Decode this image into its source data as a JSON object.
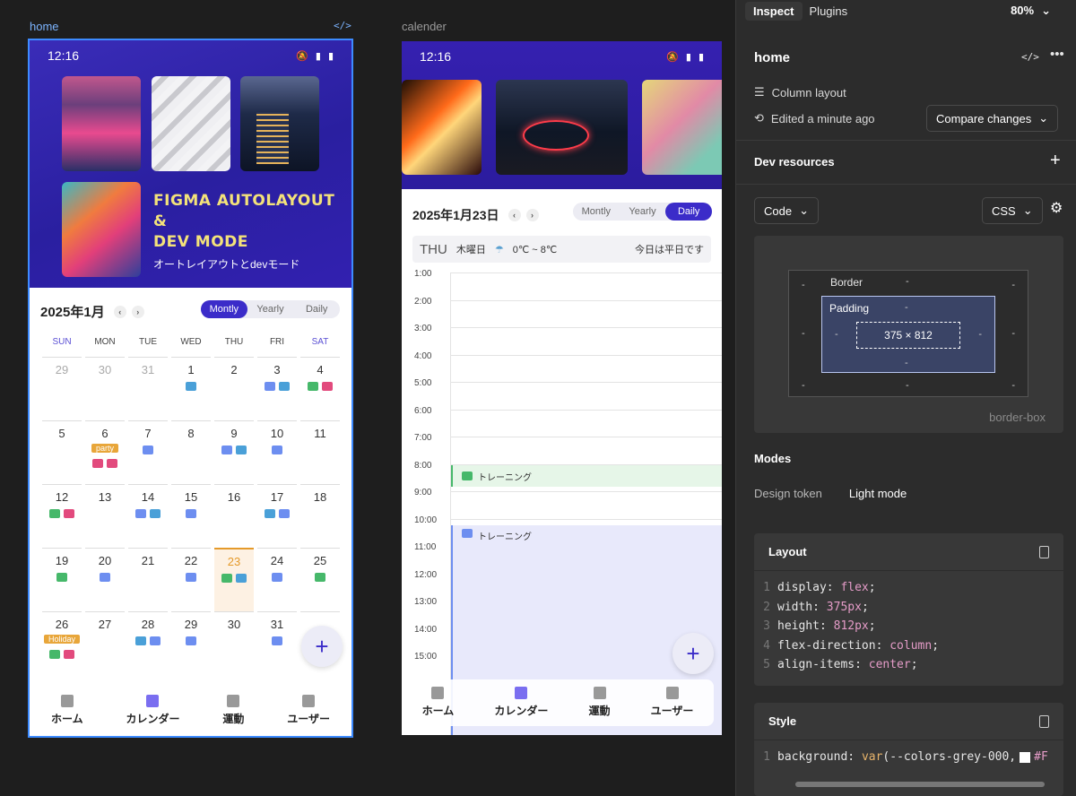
{
  "canvas": {
    "home_label": "home",
    "calender_label": "calender",
    "code_tag": "</>"
  },
  "home": {
    "time": "12:16",
    "hero_title_1": "FIGMA AUTOLAYOUT",
    "hero_title_2": "&",
    "hero_title_3": "DEV MODE",
    "hero_sub": "オートレイアウトとdevモード",
    "month_title": "2025年1月",
    "seg": [
      "Montly",
      "Yearly",
      "Daily"
    ],
    "active_seg": "Montly",
    "dow": [
      "SUN",
      "MON",
      "TUE",
      "WED",
      "THU",
      "FRI",
      "SAT"
    ],
    "days": [
      {
        "d": "29",
        "dim": true,
        "ev": []
      },
      {
        "d": "30",
        "dim": true,
        "ev": []
      },
      {
        "d": "31",
        "dim": true,
        "ev": []
      },
      {
        "d": "1",
        "ev": [
          "bldg"
        ]
      },
      {
        "d": "2",
        "ev": []
      },
      {
        "d": "3",
        "ev": [
          "pc",
          "bldg"
        ]
      },
      {
        "d": "4",
        "ev": [
          "gym",
          "party"
        ]
      },
      {
        "d": "5",
        "ev": []
      },
      {
        "d": "6",
        "tag": "party",
        "ev": [
          "party",
          "party"
        ]
      },
      {
        "d": "7",
        "ev": [
          "pc"
        ]
      },
      {
        "d": "8",
        "ev": []
      },
      {
        "d": "9",
        "ev": [
          "pc",
          "bldg"
        ]
      },
      {
        "d": "10",
        "ev": [
          "pc"
        ]
      },
      {
        "d": "11",
        "ev": []
      },
      {
        "d": "12",
        "ev": [
          "gym",
          "party"
        ]
      },
      {
        "d": "13",
        "ev": []
      },
      {
        "d": "14",
        "ev": [
          "pc",
          "bldg"
        ]
      },
      {
        "d": "15",
        "ev": [
          "pc"
        ]
      },
      {
        "d": "16",
        "ev": []
      },
      {
        "d": "17",
        "ev": [
          "bldg",
          "pc"
        ]
      },
      {
        "d": "18",
        "ev": []
      },
      {
        "d": "19",
        "ev": [
          "gym"
        ]
      },
      {
        "d": "20",
        "ev": [
          "pc"
        ]
      },
      {
        "d": "21",
        "ev": []
      },
      {
        "d": "22",
        "ev": [
          "pc"
        ]
      },
      {
        "d": "23",
        "today": true,
        "ev": [
          "gym",
          "bldg"
        ]
      },
      {
        "d": "24",
        "ev": [
          "pc"
        ]
      },
      {
        "d": "25",
        "ev": [
          "gym"
        ]
      },
      {
        "d": "26",
        "tag": "Holiday",
        "ev": [
          "gym",
          "party"
        ]
      },
      {
        "d": "27",
        "ev": []
      },
      {
        "d": "28",
        "ev": [
          "bldg",
          "pc"
        ]
      },
      {
        "d": "29",
        "ev": [
          "pc"
        ]
      },
      {
        "d": "30",
        "ev": []
      },
      {
        "d": "31",
        "ev": [
          "pc"
        ]
      },
      {
        "d": "",
        "ev": []
      }
    ],
    "fab": "+",
    "nav": [
      {
        "label": "ホーム",
        "icon": "home-icon"
      },
      {
        "label": "カレンダー",
        "icon": "calendar-icon",
        "active": true
      },
      {
        "label": "運動",
        "icon": "dumbbell-icon"
      },
      {
        "label": "ユーザー",
        "icon": "user-icon"
      }
    ]
  },
  "calender": {
    "time": "12:16",
    "day_title": "2025年1月23日",
    "seg": [
      "Montly",
      "Yearly",
      "Daily"
    ],
    "active_seg": "Daily",
    "weather": {
      "dow_en": "THU",
      "dow_jp": "木曜日",
      "temp": "0℃ ~ 8℃",
      "note": "今日は平日です"
    },
    "hours": [
      "1:00",
      "2:00",
      "3:00",
      "4:00",
      "5:00",
      "6:00",
      "7:00",
      "8:00",
      "9:00",
      "10:00",
      "11:00",
      "12:00",
      "13:00",
      "14:00",
      "15:00"
    ],
    "events": [
      {
        "label": "トレーニング",
        "type": "gym"
      },
      {
        "label": "トレーニング",
        "type": "pc"
      }
    ],
    "fab": "+",
    "nav": [
      "ホーム",
      "カレンダー",
      "運動",
      "ユーザー"
    ]
  },
  "panel": {
    "tabs": [
      "Inspect",
      "Plugins"
    ],
    "zoom": "80%",
    "title": "home",
    "column_layout": "Column layout",
    "edited": "Edited a minute ago",
    "compare": "Compare changes",
    "dev_resources": "Dev resources",
    "code_select": "Code",
    "css_select": "CSS",
    "box": {
      "border": "Border",
      "padding": "Padding",
      "size": "375 × 812",
      "dash": "-",
      "sizing": "border-box"
    },
    "modes": "Modes",
    "design_token": "Design token",
    "light_mode": "Light mode",
    "layout_title": "Layout",
    "layout_code": [
      {
        "k": "display",
        "v": "flex"
      },
      {
        "k": "width",
        "v": "375px"
      },
      {
        "k": "height",
        "v": "812px"
      },
      {
        "k": "flex-direction",
        "v": "column"
      },
      {
        "k": "align-items",
        "v": "center"
      }
    ],
    "style_title": "Style",
    "style_code": {
      "k": "background",
      "fn": "var",
      "v": "(--colors-grey-000, ",
      "tail": "#F"
    }
  }
}
